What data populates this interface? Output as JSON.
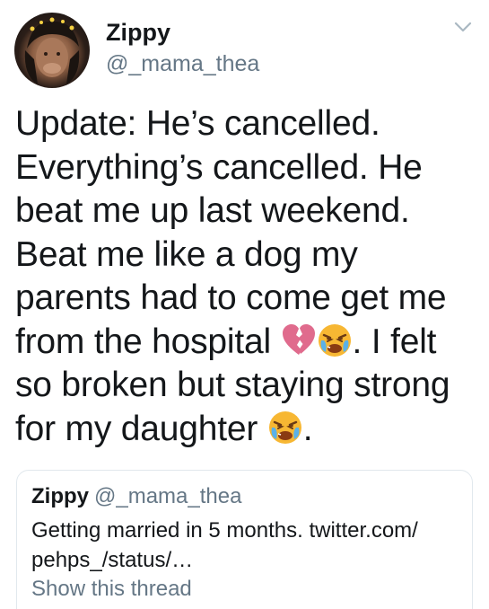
{
  "author": {
    "name": "Zippy",
    "handle": "@_mama_thea",
    "avatar": "profile-photo"
  },
  "header": {
    "menu_icon": "chevron-down-icon"
  },
  "tweet": {
    "lines": [
      "Update: He’s cancelled.",
      "Everything’s cancelled. He",
      "beat me up last weekend.",
      "Beat me like a dog my",
      "parents had to come get me",
      "from the hospital ",
      ". I felt",
      "so broken but staying strong",
      "for my daughter ",
      "."
    ],
    "emojis": [
      "broken-heart-icon",
      "crying-face-icon",
      "crying-face-icon"
    ]
  },
  "quoted_tweet": {
    "name": "Zippy",
    "handle": "@_mama_thea",
    "lines": [
      "Getting married in 5 months. twitter.com/",
      "pehps_/status/…"
    ],
    "show_thread": "Show this thread"
  },
  "colors": {
    "text": "#14171a",
    "secondary": "#657786",
    "border": "#e1e8ed"
  }
}
